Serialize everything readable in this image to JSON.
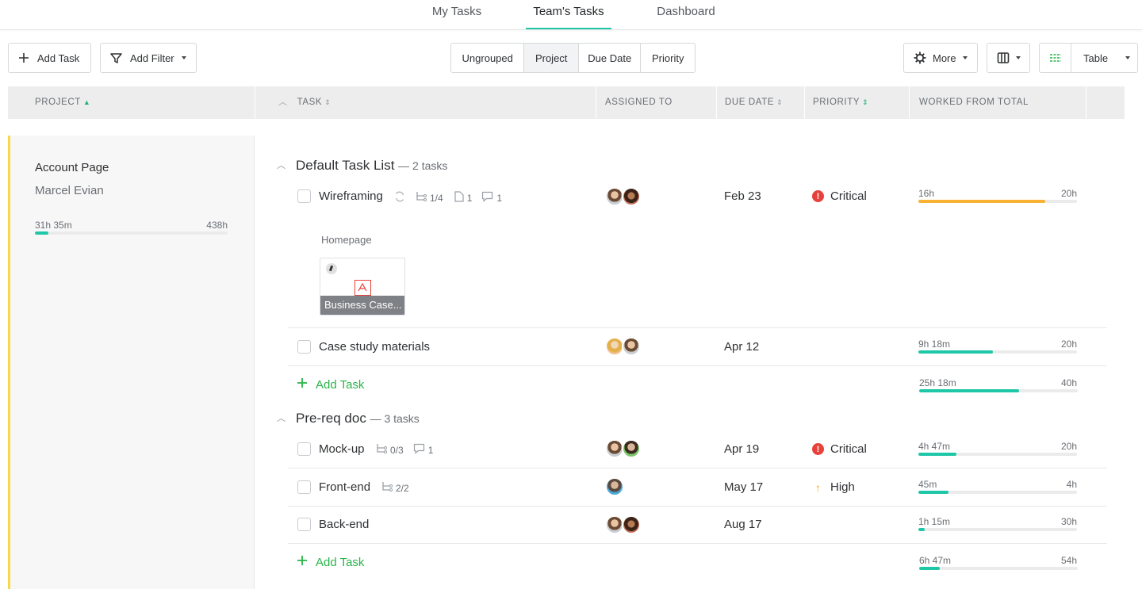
{
  "nav": {
    "tabs": [
      "My Tasks",
      "Team's Tasks",
      "Dashboard"
    ],
    "active": "Team's Tasks"
  },
  "toolbar": {
    "add_task": "Add Task",
    "add_filter": "Add Filter",
    "grouping": [
      "Ungrouped",
      "Project",
      "Due Date",
      "Priority"
    ],
    "grouping_active": "Project",
    "more": "More",
    "view": "Table"
  },
  "columns": {
    "project": "PROJECT",
    "task": "TASK",
    "assigned": "ASSIGNED TO",
    "due": "DUE DATE",
    "priority": "PRIORITY",
    "worked": "WORKED FROM TOTAL"
  },
  "project": {
    "name": "Account Page",
    "owner": "Marcel Evian",
    "worked": "31h 35m",
    "total": "438h",
    "progress": 0.072
  },
  "groups": [
    {
      "title": "Default Task List",
      "count": "— 2 tasks",
      "tasks": [
        {
          "name": "Wireframing",
          "subtasks": "1/4",
          "files": "1",
          "comments": "1",
          "due": "Feb 23",
          "priority": "Critical",
          "worked": "16h",
          "total": "20h",
          "progress": 0.8,
          "attachment": {
            "section": "Homepage",
            "file": "Business Case..."
          }
        },
        {
          "name": "Case study materials",
          "due": "Apr 12",
          "priority": "",
          "worked": "9h 18m",
          "total": "20h",
          "progress": 0.47
        }
      ],
      "add_task": "Add Task",
      "sum": {
        "worked": "25h 18m",
        "total": "40h",
        "progress": 0.63
      }
    },
    {
      "title": "Pre-req doc",
      "count": "— 3 tasks",
      "tasks": [
        {
          "name": "Mock-up",
          "subtasks": "0/3",
          "comments": "1",
          "due": "Apr 19",
          "priority": "Critical",
          "worked": "4h 47m",
          "total": "20h",
          "progress": 0.24
        },
        {
          "name": "Front-end",
          "subtasks": "2/2",
          "due": "May 17",
          "priority": "High",
          "worked": "45m",
          "total": "4h",
          "progress": 0.19
        },
        {
          "name": "Back-end",
          "due": "Aug 17",
          "priority": "",
          "worked": "1h 15m",
          "total": "30h",
          "progress": 0.04
        }
      ],
      "add_task": "Add Task",
      "sum": {
        "worked": "6h 47m",
        "total": "54h",
        "progress": 0.13
      }
    }
  ],
  "colors": {
    "accent": "#1ec7a7",
    "critical": "#e8413c",
    "high": "#f5a623",
    "add": "#28b44a",
    "project_stripe": "#f6d94a"
  }
}
